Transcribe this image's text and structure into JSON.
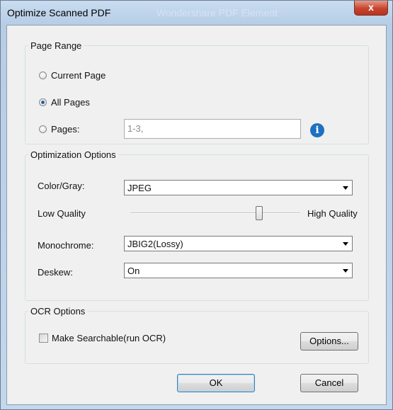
{
  "window": {
    "title": "Optimize Scanned PDF",
    "ghost_title": "Wondershare PDF Element",
    "close_symbol": "x"
  },
  "page_range": {
    "title": "Page Range",
    "options": [
      {
        "label": "Current Page",
        "checked": false
      },
      {
        "label": "All Pages",
        "checked": true
      },
      {
        "label": "Pages:",
        "checked": false
      }
    ],
    "pages_value": "1-3,",
    "info_symbol": "i"
  },
  "optimization": {
    "title": "Optimization Options",
    "color_gray_label": "Color/Gray:",
    "color_gray_value": "JPEG",
    "low_quality_label": "Low Quality",
    "high_quality_label": "High Quality",
    "quality_level": 0.76,
    "monochrome_label": "Monochrome:",
    "monochrome_value": "JBIG2(Lossy)",
    "deskew_label": "Deskew:",
    "deskew_value": "On"
  },
  "ocr": {
    "title": "OCR Options",
    "make_searchable_label": "Make Searchable(run OCR)",
    "make_searchable_checked": false,
    "options_button": "Options..."
  },
  "footer": {
    "ok_label": "OK",
    "cancel_label": "Cancel"
  }
}
